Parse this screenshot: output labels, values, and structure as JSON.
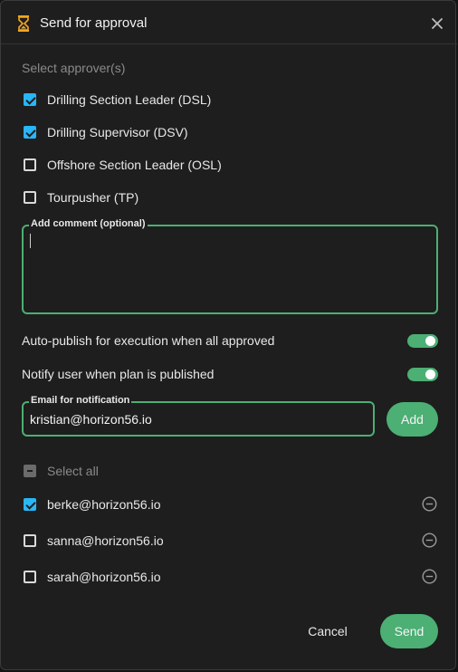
{
  "dialog": {
    "title": "Send for approval",
    "icon": "hourglass-icon",
    "accent": "#4caf73",
    "icon_color": "#f5a623",
    "check_color": "#29b6f6"
  },
  "approvers": {
    "label": "Select approver(s)",
    "items": [
      {
        "label": "Drilling Section Leader (DSL)",
        "checked": true
      },
      {
        "label": "Drilling Supervisor (DSV)",
        "checked": true
      },
      {
        "label": "Offshore Section Leader (OSL)",
        "checked": false
      },
      {
        "label": "Tourpusher (TP)",
        "checked": false
      }
    ]
  },
  "comment": {
    "label": "Add comment (optional)",
    "value": ""
  },
  "toggles": {
    "auto_publish": {
      "label": "Auto-publish for execution when all approved",
      "on": true
    },
    "notify": {
      "label": "Notify user when plan is published",
      "on": true
    }
  },
  "email": {
    "label": "Email for notification",
    "value": "kristian@horizon56.io",
    "add_label": "Add"
  },
  "recipients": {
    "select_all_label": "Select all",
    "items": [
      {
        "email": "berke@horizon56.io",
        "checked": true
      },
      {
        "email": "sanna@horizon56.io",
        "checked": false
      },
      {
        "email": "sarah@horizon56.io",
        "checked": false
      }
    ]
  },
  "actions": {
    "cancel": "Cancel",
    "send": "Send"
  }
}
